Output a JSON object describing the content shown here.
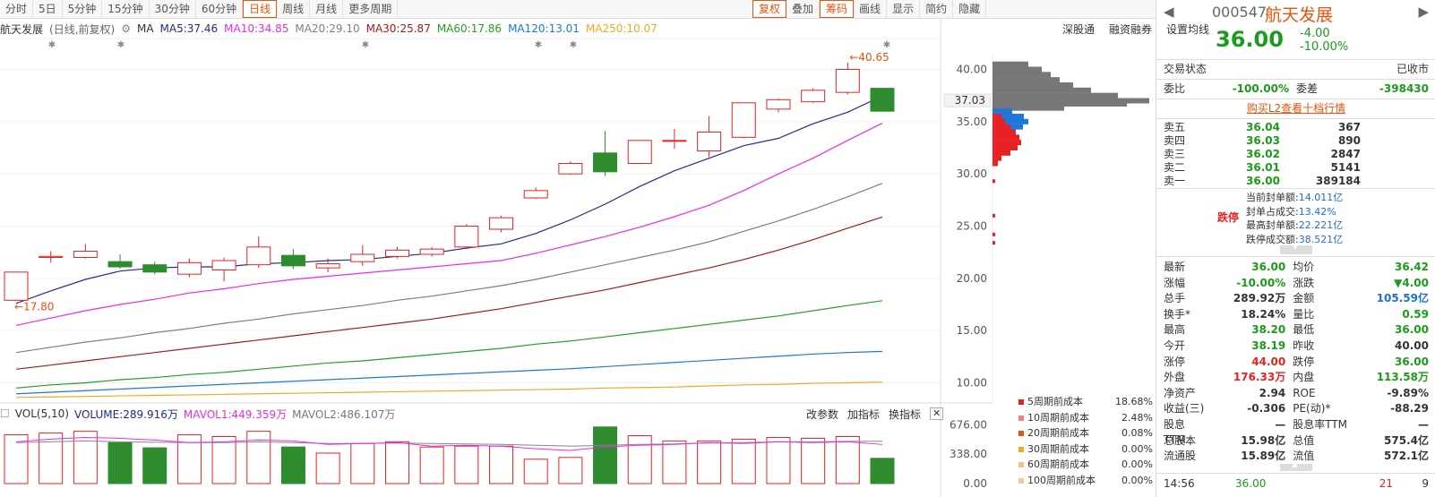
{
  "toolbar": {
    "periods": [
      "分时",
      "5日",
      "5分钟",
      "15分钟",
      "30分钟",
      "60分钟",
      "日线",
      "周线",
      "月线",
      "更多周期"
    ],
    "active": "日线",
    "right": [
      "复权",
      "叠加",
      "筹码",
      "画线",
      "显示",
      "简约",
      "隐藏"
    ]
  },
  "ma": {
    "stock": "航天发展",
    "mode": "(日线,前复权)",
    "label": "MA",
    "ma5": "MA5:37.46",
    "ma10": "MA10:34.85",
    "ma20": "MA20:29.10",
    "ma30": "MA30:25.87",
    "ma60": "MA60:17.86",
    "ma120": "MA120:13.01",
    "ma250": "MA250:10.07",
    "right_links": [
      "深股通",
      "融资融券",
      "设置均线"
    ]
  },
  "colors": {
    "ma5": "#1f2d8a",
    "ma10": "#ee2ae6",
    "ma20": "#7f7f7f",
    "ma30": "#a01c1c",
    "ma60": "#22a022",
    "ma120": "#1e78d8",
    "ma250": "#f5a623",
    "up": "#e62222",
    "down": "#2e8b2e"
  },
  "vol": {
    "label": "VOL(5,10)",
    "volume": "VOLUME:289.916万",
    "mavol1": "MAVOL1:449.359万",
    "mavol2": "MAVOL2:486.107万",
    "buttons": [
      "改参数",
      "加指标",
      "换指标"
    ]
  },
  "cost": [
    {
      "label": "5周期前成本",
      "value": "18.68%",
      "color": "#e62222"
    },
    {
      "label": "10周期前成本",
      "value": "2.48%",
      "color": "#f08080"
    },
    {
      "label": "20周期前成本",
      "value": "0.08%",
      "color": "#e8530e"
    },
    {
      "label": "30周期前成本",
      "value": "0.00%",
      "color": "#f5a623"
    },
    {
      "label": "60周期前成本",
      "value": "0.00%",
      "color": "#f7c27a"
    },
    {
      "label": "100周期前成本",
      "value": "0.00%",
      "color": "#f5c89a"
    }
  ],
  "panel": {
    "code": "000547",
    "name": "航天发展",
    "price": "36.00",
    "chg": "-4.00",
    "pct": "-10.00%",
    "trade_status_label": "交易状态",
    "trade_status": "已收市",
    "weibi_label": "委比",
    "weibi": "-100.00%",
    "weicha_label": "委差",
    "weicha": "-398430",
    "l2": "购买L2查看十档行情",
    "asks": [
      {
        "label": "卖五",
        "price": "36.04",
        "vol": "367"
      },
      {
        "label": "卖四",
        "price": "36.03",
        "vol": "890"
      },
      {
        "label": "卖三",
        "price": "36.02",
        "vol": "2847"
      },
      {
        "label": "卖二",
        "price": "36.01",
        "vol": "5141"
      },
      {
        "label": "卖一",
        "price": "36.00",
        "vol": "389184"
      }
    ],
    "limit_label": "跌停",
    "limit_rows": [
      {
        "k": "当前封单额:",
        "v": "14.011亿"
      },
      {
        "k": "封单占成交:",
        "v": "13.42%"
      },
      {
        "k": "最高封单额:",
        "v": "22.221亿"
      },
      {
        "k": "跌停成交额:",
        "v": "38.521亿"
      }
    ],
    "stats": [
      {
        "k1": "最新",
        "v1": "36.00",
        "c1": "green",
        "k2": "均价",
        "v2": "36.42",
        "c2": "green"
      },
      {
        "k1": "涨幅",
        "v1": "-10.00%",
        "c1": "green",
        "k2": "涨跌",
        "v2": "▼4.00",
        "c2": "green"
      },
      {
        "k1": "总手",
        "v1": "289.92万",
        "c1": "",
        "k2": "金额",
        "v2": "105.59亿",
        "c2": "blue"
      },
      {
        "k1": "换手*",
        "v1": "18.24%",
        "c1": "",
        "k2": "量比",
        "v2": "0.59",
        "c2": "green"
      },
      {
        "k1": "最高",
        "v1": "38.20",
        "c1": "green",
        "k2": "最低",
        "v2": "36.00",
        "c2": "green"
      },
      {
        "k1": "今开",
        "v1": "38.19",
        "c1": "green",
        "k2": "昨收",
        "v2": "40.00",
        "c2": ""
      },
      {
        "k1": "涨停",
        "v1": "44.00",
        "c1": "red",
        "k2": "跌停",
        "v2": "36.00",
        "c2": "green"
      },
      {
        "k1": "外盘",
        "v1": "176.33万",
        "c1": "red",
        "k2": "内盘",
        "v2": "113.58万",
        "c2": "green"
      },
      {
        "k1": "净资产",
        "v1": "2.94",
        "c1": "",
        "k2": "ROE",
        "v2": "-9.89%",
        "c2": ""
      },
      {
        "k1": "收益(三)",
        "v1": "-0.306",
        "c1": "",
        "k2": "PE(动)*",
        "v2": "-88.29",
        "c2": ""
      },
      {
        "k1": "股息TTM",
        "v1": "—",
        "c1": "",
        "k2": "股息率TTM",
        "v2": "—",
        "c2": ""
      },
      {
        "k1": "总股本",
        "v1": "15.98亿",
        "c1": "",
        "k2": "总值",
        "v2": "575.4亿",
        "c2": ""
      },
      {
        "k1": "流通股",
        "v1": "15.89亿",
        "c1": "",
        "k2": "流值",
        "v2": "572.1亿",
        "c2": ""
      }
    ],
    "tick_time": "14:56",
    "tick_price": "36.00",
    "tick_vol": "21",
    "tick_n": "9"
  },
  "chart_data": {
    "type": "candlestick",
    "price_axis": {
      "ticks": [
        "40.00",
        "35.00",
        "30.00",
        "25.00",
        "20.00",
        "15.00",
        "10.00"
      ],
      "ylim": [
        8.5,
        41.5
      ]
    },
    "marker_price": "37.03",
    "high_label": "40.65",
    "low_label": "17.80",
    "candles": [
      {
        "o": 17.9,
        "h": 20.6,
        "l": 17.8,
        "c": 20.6
      },
      {
        "o": 22.0,
        "h": 22.6,
        "l": 21.5,
        "c": 22.1
      },
      {
        "o": 22.0,
        "h": 23.3,
        "l": 21.9,
        "c": 22.6
      },
      {
        "o": 21.6,
        "h": 22.3,
        "l": 20.9,
        "c": 21.1
      },
      {
        "o": 21.3,
        "h": 21.6,
        "l": 20.4,
        "c": 20.6
      },
      {
        "o": 20.4,
        "h": 21.9,
        "l": 20.1,
        "c": 21.5
      },
      {
        "o": 20.8,
        "h": 22.0,
        "l": 19.7,
        "c": 21.7
      },
      {
        "o": 21.3,
        "h": 24.0,
        "l": 21.0,
        "c": 23.0
      },
      {
        "o": 22.2,
        "h": 22.8,
        "l": 20.9,
        "c": 21.2
      },
      {
        "o": 21.0,
        "h": 21.9,
        "l": 20.6,
        "c": 21.4
      },
      {
        "o": 21.6,
        "h": 23.2,
        "l": 21.2,
        "c": 22.3
      },
      {
        "o": 22.1,
        "h": 23.0,
        "l": 21.9,
        "c": 22.7
      },
      {
        "o": 22.3,
        "h": 23.0,
        "l": 22.1,
        "c": 22.8
      },
      {
        "o": 23.0,
        "h": 25.2,
        "l": 22.8,
        "c": 25.0
      },
      {
        "o": 24.7,
        "h": 26.0,
        "l": 24.4,
        "c": 25.8
      },
      {
        "o": 27.7,
        "h": 28.7,
        "l": 27.6,
        "c": 28.4
      },
      {
        "o": 30.0,
        "h": 31.2,
        "l": 29.9,
        "c": 31.0
      },
      {
        "o": 32.0,
        "h": 34.1,
        "l": 29.8,
        "c": 30.2
      },
      {
        "o": 31.0,
        "h": 33.2,
        "l": 31.0,
        "c": 33.2
      },
      {
        "o": 33.2,
        "h": 34.3,
        "l": 32.4,
        "c": 33.2
      },
      {
        "o": 32.2,
        "h": 35.5,
        "l": 31.6,
        "c": 34.0
      },
      {
        "o": 33.5,
        "h": 36.8,
        "l": 33.4,
        "c": 36.8
      },
      {
        "o": 36.2,
        "h": 37.2,
        "l": 35.9,
        "c": 37.1
      },
      {
        "o": 36.9,
        "h": 38.2,
        "l": 36.8,
        "c": 38.0
      },
      {
        "o": 37.8,
        "h": 40.65,
        "l": 37.6,
        "c": 40.0
      },
      {
        "o": 38.19,
        "h": 38.2,
        "l": 36.0,
        "c": 36.0
      }
    ],
    "ma5": [
      17.6,
      18.8,
      19.9,
      20.7,
      21.0,
      21.1,
      21.1,
      21.4,
      21.5,
      21.7,
      21.8,
      22.1,
      22.4,
      22.9,
      23.3,
      24.3,
      25.6,
      27.1,
      28.8,
      30.3,
      31.5,
      32.7,
      33.4,
      34.8,
      35.9,
      37.46
    ],
    "ma10": [
      15.5,
      16.2,
      16.9,
      17.5,
      18.0,
      18.6,
      19.0,
      19.5,
      19.9,
      20.2,
      20.5,
      20.8,
      21.1,
      21.4,
      21.7,
      22.4,
      23.2,
      24.0,
      24.9,
      25.9,
      27.0,
      28.4,
      30.0,
      31.5,
      33.2,
      34.85
    ],
    "ma20": [
      12.9,
      13.4,
      13.9,
      14.3,
      14.8,
      15.2,
      15.7,
      16.1,
      16.6,
      17.0,
      17.4,
      17.9,
      18.3,
      18.8,
      19.3,
      19.9,
      20.6,
      21.3,
      22.0,
      22.7,
      23.5,
      24.5,
      25.5,
      26.6,
      27.8,
      29.1
    ],
    "ma30": [
      11.3,
      11.7,
      12.1,
      12.5,
      12.9,
      13.3,
      13.7,
      14.1,
      14.5,
      14.9,
      15.3,
      15.7,
      16.1,
      16.6,
      17.1,
      17.7,
      18.3,
      18.9,
      19.6,
      20.3,
      21.0,
      21.8,
      22.7,
      23.7,
      24.8,
      25.87
    ],
    "ma60": [
      9.5,
      9.8,
      10.0,
      10.3,
      10.5,
      10.8,
      11.0,
      11.3,
      11.6,
      11.9,
      12.1,
      12.4,
      12.7,
      13.0,
      13.3,
      13.7,
      14.0,
      14.4,
      14.8,
      15.2,
      15.6,
      16.0,
      16.4,
      16.9,
      17.4,
      17.86
    ],
    "ma120": [
      8.95,
      9.1,
      9.25,
      9.4,
      9.55,
      9.7,
      9.85,
      10.0,
      10.15,
      10.3,
      10.45,
      10.6,
      10.75,
      10.9,
      11.05,
      11.2,
      11.35,
      11.55,
      11.75,
      11.95,
      12.15,
      12.35,
      12.55,
      12.75,
      12.9,
      13.01
    ],
    "ma250": [
      8.6,
      8.65,
      8.7,
      8.75,
      8.8,
      8.85,
      8.9,
      8.95,
      9.0,
      9.05,
      9.1,
      9.15,
      9.2,
      9.25,
      9.3,
      9.35,
      9.4,
      9.5,
      9.55,
      9.6,
      9.7,
      9.8,
      9.85,
      9.95,
      10.0,
      10.07
    ],
    "vol_axis": {
      "ticks": [
        "676.00",
        "338.00",
        "0.00"
      ],
      "ylim": [
        0,
        720
      ]
    },
    "volumes": [
      560,
      580,
      600,
      470,
      410,
      560,
      540,
      600,
      420,
      350,
      460,
      480,
      420,
      430,
      430,
      280,
      300,
      650,
      550,
      490,
      490,
      510,
      530,
      520,
      540,
      289.916
    ],
    "mavol1": [
      480,
      510,
      530,
      520,
      500,
      470,
      480,
      500,
      490,
      450,
      460,
      470,
      430,
      440,
      430,
      400,
      380,
      420,
      440,
      450,
      470,
      460,
      480,
      470,
      480,
      449.359
    ],
    "mavol2": [
      470,
      480,
      490,
      480,
      475,
      470,
      470,
      480,
      470,
      460,
      460,
      465,
      460,
      455,
      450,
      440,
      430,
      440,
      450,
      455,
      465,
      470,
      480,
      480,
      485,
      486.107
    ]
  }
}
